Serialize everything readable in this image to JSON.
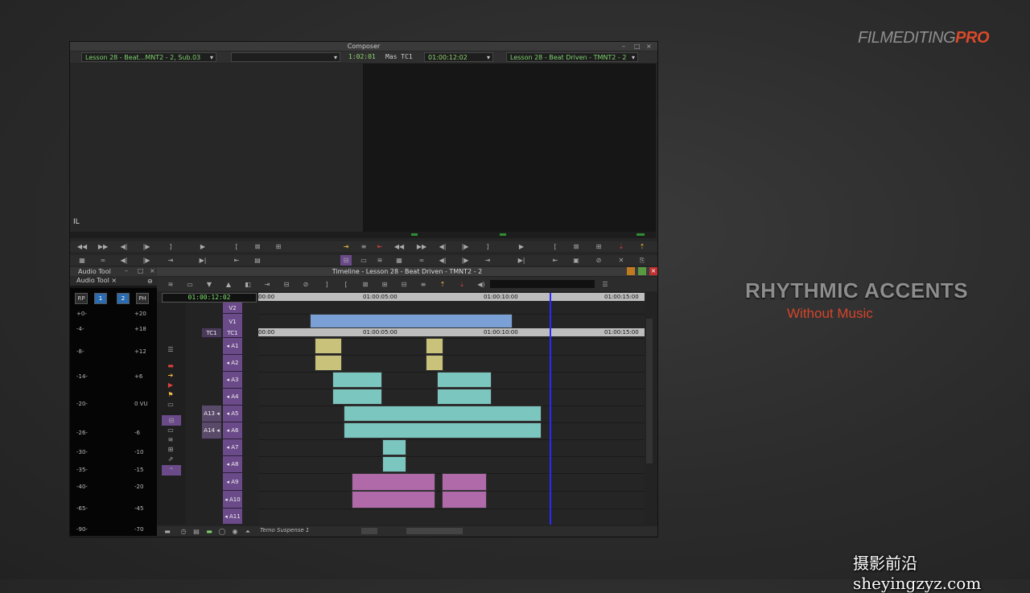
{
  "brand": {
    "part1": "FILMEDITING",
    "part2": "PRO"
  },
  "overlay": {
    "title": "RHYTHMIC ACCENTS",
    "subtitle": "Without Music"
  },
  "watermark": "摄影前沿 sheyingzyz.com",
  "composer": {
    "title": "Composer",
    "source_clip": "Lesson 28 - Beat...MNT2 - 2, Sub.03",
    "source_tc": "1:02:01",
    "mas_label": "Mas TC1",
    "record_tc": "01:00:12:02",
    "record_sequence": "Lesson 28 - Beat Driven - TMNT2 - 2",
    "il": "IL"
  },
  "audio_tool": {
    "title": "Audio Tool",
    "tab": "Audio Tool",
    "close": "×",
    "buttons": [
      "RP",
      "1",
      "2",
      "PH"
    ],
    "left_scale": [
      "+0-",
      "-4-",
      "-8-",
      "-14-",
      "-20-",
      "-26-",
      "-30-",
      "-35-",
      "-40-",
      "-65-",
      "-90-"
    ],
    "right_scale": [
      "+20",
      "+18",
      "+12",
      "+6",
      "0 VU",
      "-6",
      "-10",
      "-15",
      "-20",
      "-45",
      "-70"
    ]
  },
  "timeline": {
    "title": "Timeline - Lesson 28 - Beat Driven - TMNT2 - 2",
    "timecode": "01:00:12:02",
    "ruler_marks": [
      "00:00",
      "01:00:05:00",
      "01:00:10:00",
      "01:00:15:00"
    ],
    "tracks": [
      "V2",
      "V1",
      "TC1",
      "A1",
      "A2",
      "A3",
      "A4",
      "A5",
      "A6",
      "A7",
      "A8",
      "A9",
      "A10",
      "A11"
    ],
    "source_tracks": [
      "TC1",
      "A13",
      "A14"
    ],
    "bottom_label": "Temo Suspense 1"
  },
  "colors": {
    "video": "#7aa0d6",
    "audio_yellow": "#c9c27a",
    "audio_teal": "#7cc6c0",
    "audio_purple": "#b06aa9",
    "track_purple": "#6b4a8a",
    "playhead": "#2a2aff"
  }
}
